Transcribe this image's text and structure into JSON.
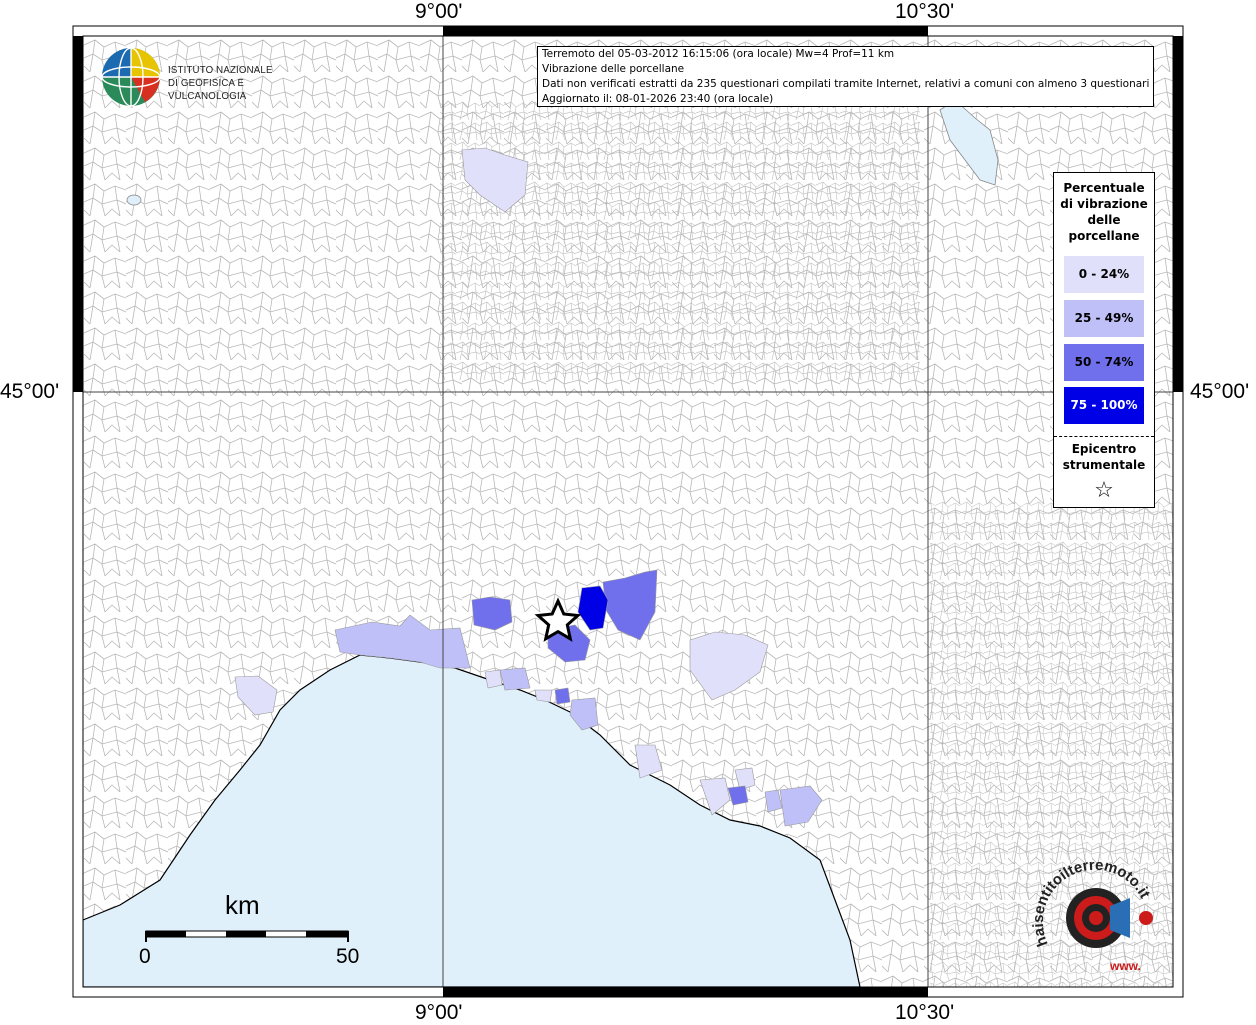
{
  "map": {
    "graticule": {
      "top_labels": [
        "9°00'",
        "10°30'"
      ],
      "bottom_labels": [
        "9°00'",
        "10°30'"
      ],
      "left_label": "45°00'",
      "right_label": "45°00'"
    },
    "colors": {
      "sea": "#dff0fb",
      "land": "#ffffff",
      "borders": "#b8b8b8",
      "frame": "#000000"
    },
    "municipalities_colored": [
      {
        "class": "0 - 24%",
        "count_visible": 8
      },
      {
        "class": "25 - 49%",
        "count_visible": 9
      },
      {
        "class": "50 - 74%",
        "count_visible": 3
      },
      {
        "class": "75 - 100%",
        "count_visible": 1
      }
    ]
  },
  "info": {
    "line1": "Terremoto del 05-03-2012 16:15:06 (ora locale) Mw=4 Prof=11 km",
    "line2": "Vibrazione delle porcellane",
    "line3": "Dati non verificati estratti da 235 questionari compilati tramite Internet, relativi a comuni con almeno 3 questionari.",
    "line4": "Aggiornato il: 08-01-2026 23:40 (ora locale)"
  },
  "logo": {
    "line1": "ISTITUTO NAZIONALE",
    "line2": "DI GEOFISICA E VULCANOLOGIA",
    "icon": "ingv-globe-icon"
  },
  "legend": {
    "title": "Percentuale di vibrazione delle porcellane",
    "items": [
      {
        "label": "0 - 24%",
        "color": "#e0e0fa",
        "text_color": "#000000"
      },
      {
        "label": "25 - 49%",
        "color": "#c0c0f8",
        "text_color": "#000000"
      },
      {
        "label": "50 - 74%",
        "color": "#7070ec",
        "text_color": "#000000"
      },
      {
        "label": "75 - 100%",
        "color": "#0000e6",
        "text_color": "#ffffff"
      }
    ],
    "epicenter_label": "Epicentro strumentale",
    "epicenter_symbol": "☆"
  },
  "scale": {
    "unit": "km",
    "min_label": "0",
    "max_label": "50"
  },
  "brand": {
    "text": "haisentitoilterremoto.it",
    "sub": "www.",
    "icon": "speaker-target-icon"
  }
}
